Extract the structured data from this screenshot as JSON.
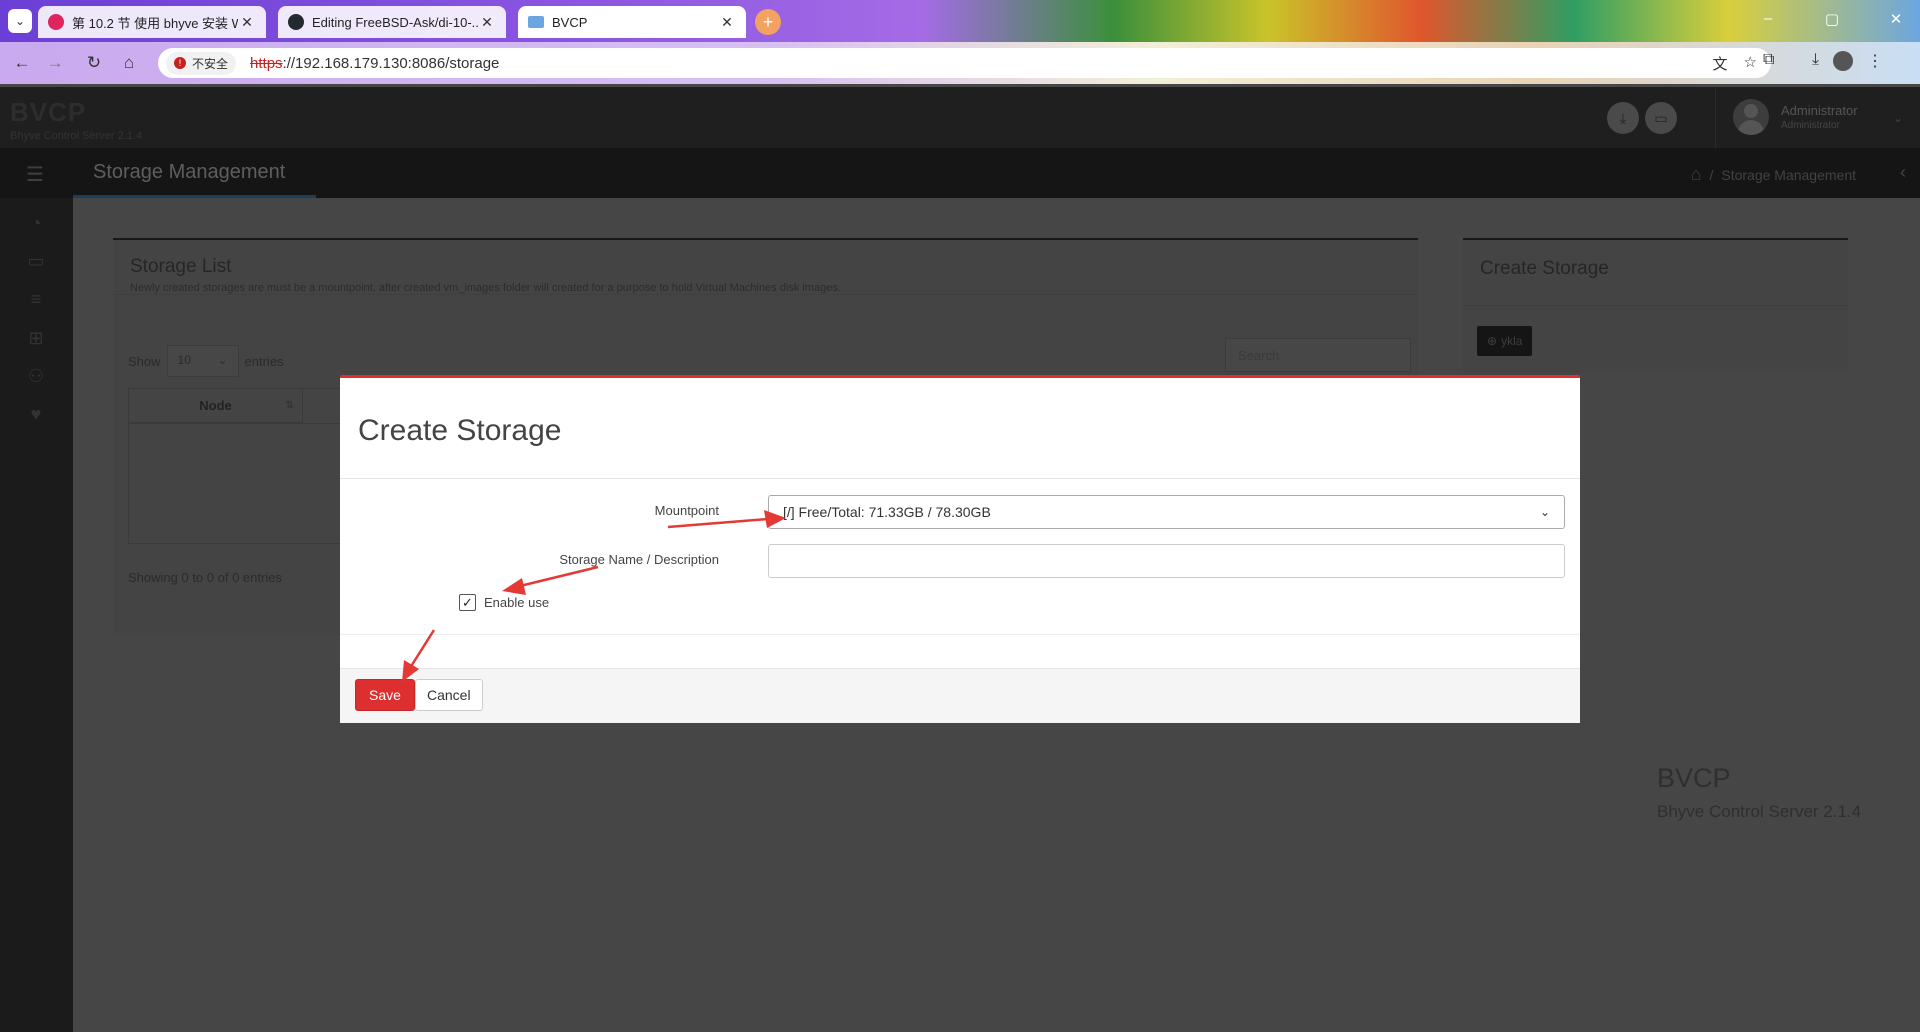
{
  "browser": {
    "tabs": [
      {
        "label": "第 10.2 节 使用 bhyve 安装 W",
        "favicon_color": "#e0245e"
      },
      {
        "label": "Editing FreeBSD-Ask/di-10-...",
        "favicon_color": "#24292f"
      },
      {
        "label": "BVCP",
        "favicon_color": "#6ca6e0"
      }
    ],
    "security_label": "不安全",
    "url_scheme": "https",
    "url_rest": "://192.168.179.130:8086/storage"
  },
  "app": {
    "brand_name": "BVCP",
    "brand_version": "Bhyve Control Server 2.1.4",
    "user_name": "Administrator",
    "user_role": "Administrator",
    "page_title": "Storage Management",
    "breadcrumb_current": "Storage Management",
    "breadcrumb_sep": "/"
  },
  "storage_list": {
    "title": "Storage List",
    "subtitle": "Newly created storages are must be a mountpoint, after created vm_images folder will created for a purpose to hold Virtual Machines disk images.",
    "show_label": "Show",
    "entries_label": "entries",
    "page_size": "10",
    "search_placeholder": "Search",
    "column_node": "Node",
    "showing_text": "Showing 0 to 0 of 0 entries"
  },
  "create_panel": {
    "title": "Create Storage",
    "button_label": "ykla"
  },
  "footer": {
    "name": "BVCP",
    "version": "Bhyve Control Server 2.1.4"
  },
  "modal": {
    "title": "Create Storage",
    "mountpoint_label": "Mountpoint",
    "mountpoint_value": "[/] Free/Total: 71.33GB / 78.30GB",
    "name_label": "Storage Name / Description",
    "name_value": "",
    "enable_label": "Enable use",
    "enable_checked": true,
    "save_label": "Save",
    "cancel_label": "Cancel"
  },
  "colors": {
    "accent_red": "#dd2f2f",
    "annotation_red": "#e53935"
  }
}
